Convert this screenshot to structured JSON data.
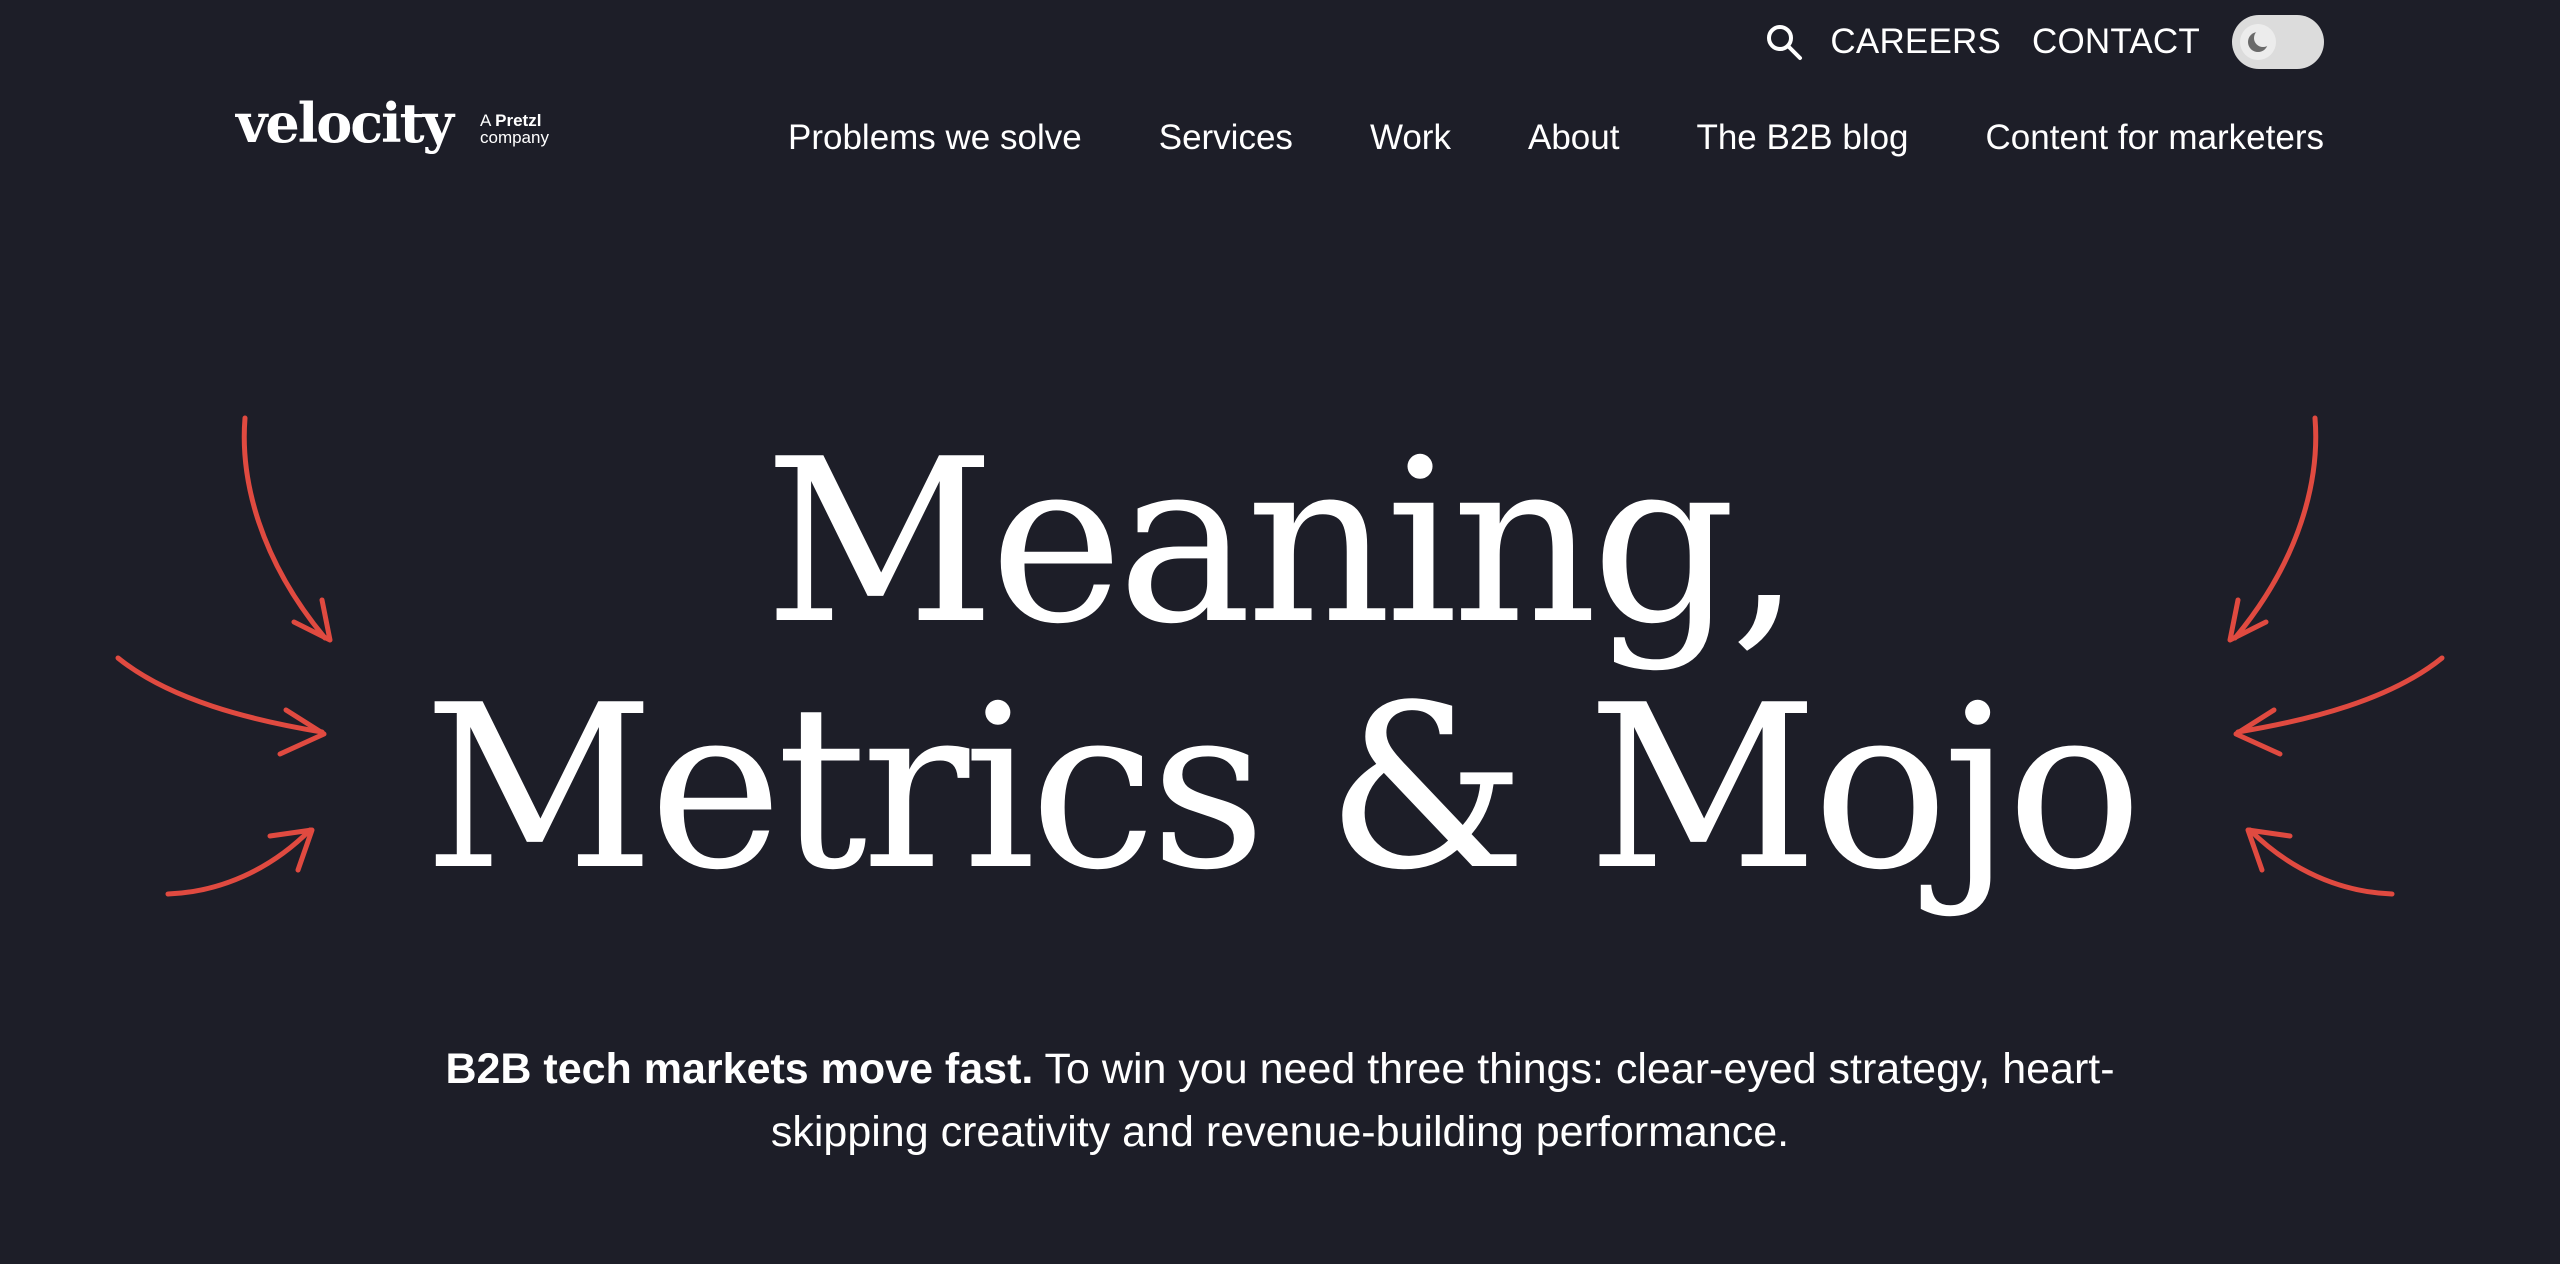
{
  "utility_bar": {
    "search_icon": "search-icon",
    "careers": "CAREERS",
    "contact": "CONTACT",
    "theme_toggle_icon": "moon-icon"
  },
  "logo": {
    "wordmark": "velocity",
    "tag_prefix": "A",
    "tag_brand": "Pretzl",
    "tag_suffix": "company"
  },
  "nav": {
    "items": [
      "Problems we solve",
      "Services",
      "Work",
      "About",
      "The B2B blog",
      "Content for marketers"
    ]
  },
  "hero": {
    "title_line1": "Meaning,",
    "title_line2": "Metrics & Mojo",
    "subtitle_bold": "B2B tech markets move fast.",
    "subtitle_rest_line1": " To win you need three things: clear-eyed strategy, heart-",
    "subtitle_line2": "skipping creativity and revenue-building performance."
  },
  "colors": {
    "background": "#1d1e28",
    "text": "#ffffff",
    "accent_arrows": "#e04a40",
    "toggle_track": "#dcdcdc"
  }
}
